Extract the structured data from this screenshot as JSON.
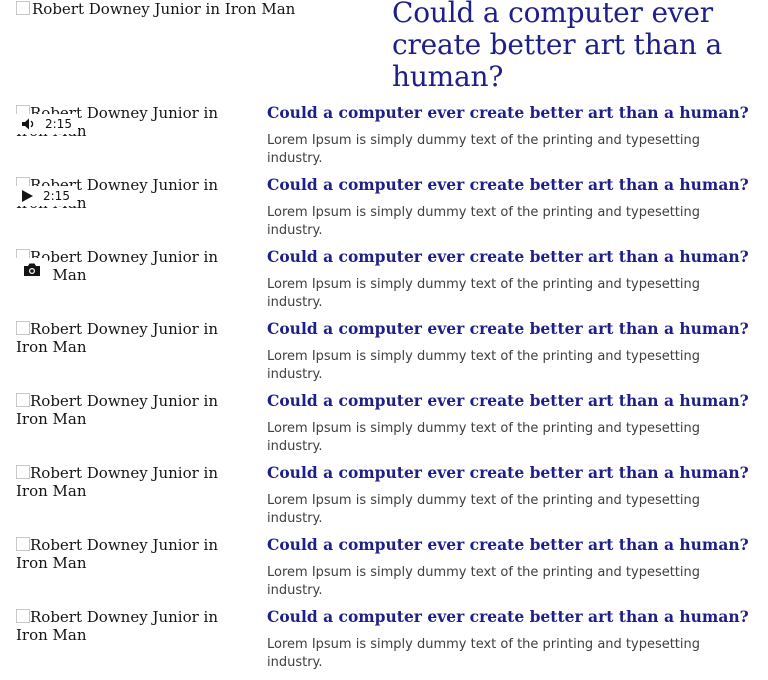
{
  "hero": {
    "image_alt": "Robert Downey Junior in Iron Man",
    "title": "Could a computer ever create better art than a human?"
  },
  "items": [
    {
      "image_alt": "Robert Downey Junior in Iron Man",
      "title": "Could a computer ever create better art than a human?",
      "summary": "Lorem Ipsum is simply dummy text of the printing and typesetting industry.",
      "media": "audio",
      "duration": "2:15"
    },
    {
      "image_alt": "Robert Downey Junior in Iron Man",
      "title": "Could a computer ever create better art than a human?",
      "summary": "Lorem Ipsum is simply dummy text of the printing and typesetting industry.",
      "media": "video",
      "duration": "2:15"
    },
    {
      "image_alt": "Robert Downey Junior in Iron Man",
      "title": "Could a computer ever create better art than a human?",
      "summary": "Lorem Ipsum is simply dummy text of the printing and typesetting industry.",
      "media": "gallery",
      "duration": ""
    },
    {
      "image_alt": "Robert Downey Junior in Iron Man",
      "title": "Could a computer ever create better art than a human?",
      "summary": "Lorem Ipsum is simply dummy text of the printing and typesetting industry.",
      "media": "",
      "duration": ""
    },
    {
      "image_alt": "Robert Downey Junior in Iron Man",
      "title": "Could a computer ever create better art than a human?",
      "summary": "Lorem Ipsum is simply dummy text of the printing and typesetting industry.",
      "media": "",
      "duration": ""
    },
    {
      "image_alt": "Robert Downey Junior in Iron Man",
      "title": "Could a computer ever create better art than a human?",
      "summary": "Lorem Ipsum is simply dummy text of the printing and typesetting industry.",
      "media": "",
      "duration": ""
    },
    {
      "image_alt": "Robert Downey Junior in Iron Man",
      "title": "Could a computer ever create better art than a human?",
      "summary": "Lorem Ipsum is simply dummy text of the printing and typesetting industry.",
      "media": "",
      "duration": ""
    },
    {
      "image_alt": "Robert Downey Junior in Iron Man",
      "title": "Could a computer ever create better art than a human?",
      "summary": "Lorem Ipsum is simply dummy text of the printing and typesetting industry.",
      "media": "",
      "duration": ""
    }
  ],
  "colors": {
    "headline": "#1f1f8a",
    "summary": "#3f3f42"
  },
  "icons": {
    "audio": "speaker-icon",
    "video": "play-icon",
    "gallery": "camera-icon",
    "image": "broken-image-icon"
  }
}
